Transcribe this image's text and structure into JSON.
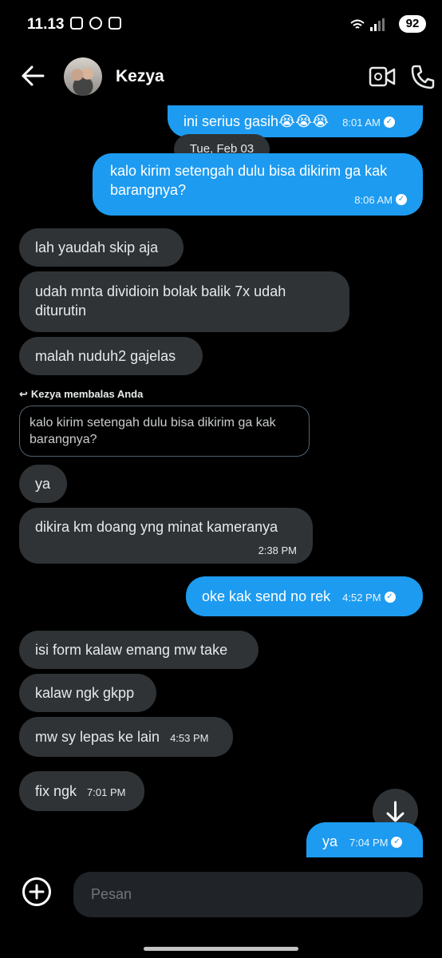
{
  "status_bar": {
    "time": "11.13",
    "battery": "92"
  },
  "header": {
    "contact_name": "Kezya"
  },
  "date_separator": "Tue, Feb 03",
  "messages": [
    {
      "dir": "out",
      "text": "ini serius gasih😭😭😭",
      "time": "8:01 AM"
    },
    {
      "dir": "out",
      "text": "kalo kirim setengah dulu bisa dikirim ga kak barangnya?",
      "time": "8:06 AM"
    },
    {
      "dir": "in",
      "text": "lah yaudah skip aja",
      "time": ""
    },
    {
      "dir": "in",
      "text": "udah mnta dividioin bolak balik 7x udah diturutin",
      "time": ""
    },
    {
      "dir": "in",
      "text": "malah nuduh2 gajelas",
      "time": ""
    },
    {
      "dir": "in",
      "text": "ya",
      "time": ""
    },
    {
      "dir": "in",
      "text": "dikira km doang yng minat kameranya",
      "time": "2:38 PM"
    },
    {
      "dir": "out",
      "text": "oke kak send no rek",
      "time": "4:52 PM"
    },
    {
      "dir": "in",
      "text": "isi form kalaw emang mw take",
      "time": ""
    },
    {
      "dir": "in",
      "text": "kalaw ngk gkpp",
      "time": ""
    },
    {
      "dir": "in",
      "text": "mw sy lepas ke lain",
      "time": "4:53 PM"
    },
    {
      "dir": "in",
      "text": "fix ngk",
      "time": "7:01 PM"
    },
    {
      "dir": "out",
      "text": "ya",
      "time": "7:04 PM"
    }
  ],
  "reply": {
    "label": "Kezya membalas Anda",
    "quoted": "kalo kirim setengah dulu bisa dikirim ga kak barangnya?"
  },
  "composer": {
    "placeholder": "Pesan"
  },
  "icons": {
    "back": "arrow-left-icon",
    "video": "video-camera-icon",
    "call": "phone-icon",
    "scroll": "arrow-down-icon",
    "add": "plus-circle-icon",
    "read_receipt": "check-circle-icon"
  },
  "colors": {
    "outgoing": "#1d9bf0",
    "incoming": "#2f3336",
    "background": "#000000"
  }
}
